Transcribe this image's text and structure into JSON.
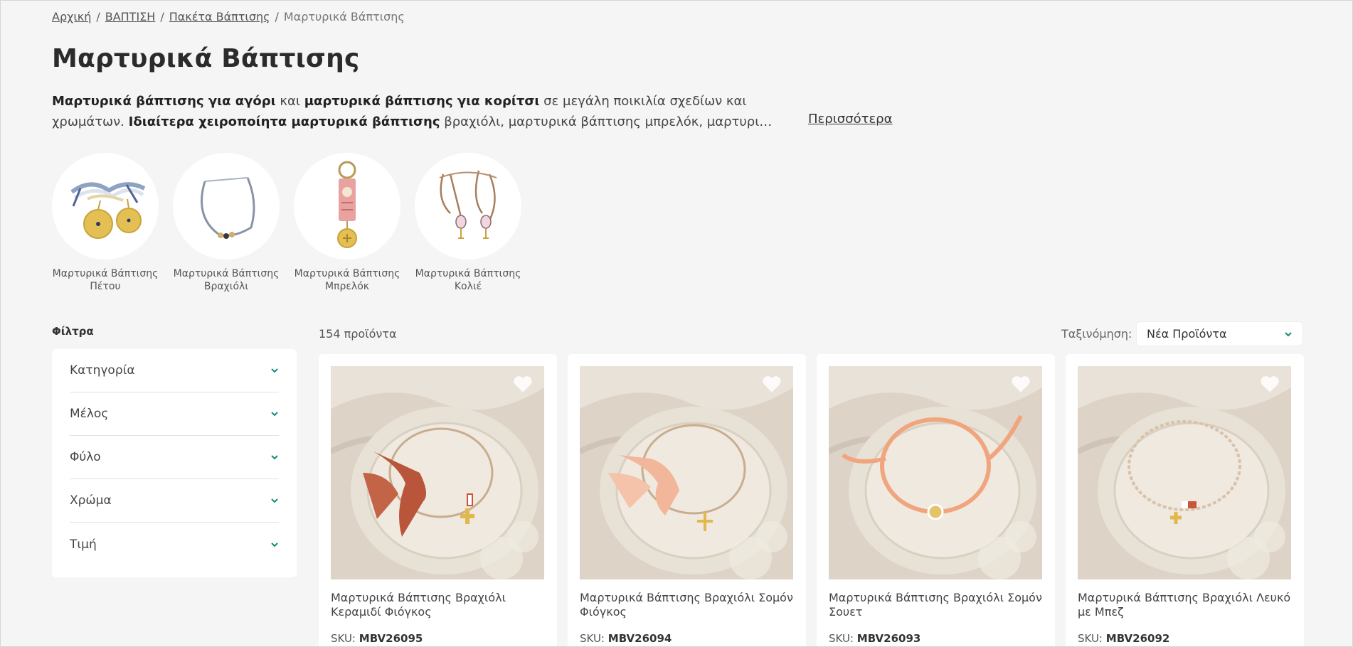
{
  "breadcrumb": {
    "items": [
      "Αρχική",
      "ΒΑΠΤΙΣΗ",
      "Πακέτα Βάπτισης"
    ],
    "current": "Μαρτυρικά Βάπτισης",
    "separator": "/"
  },
  "page_title": "Μαρτυρικά Βάπτισης",
  "intro": {
    "l1_b1": "Μαρτυρικά βάπτισης για αγόρι",
    "l1_t1": " και ",
    "l1_b2": "μαρτυρικά βάπτισης για κορίτσι",
    "l1_t2": " σε μεγάλη ποικιλία σχεδίων και",
    "l2_t1": "χρωμάτων. ",
    "l2_b1": "Ιδιαίτερα χειροποίητα μαρτυρικά βάπτισης",
    "l2_t2": " βραχιόλι, μαρτυρικά βάπτισης μπρελόκ, μαρτυρι…",
    "more_link": "Περισσότερα"
  },
  "categories": [
    {
      "line1": "Μαρτυρικά Βάπτισης",
      "line2": "Πέτου",
      "icon": "coin-pin-icon"
    },
    {
      "line1": "Μαρτυρικά Βάπτισης",
      "line2": "Βραχιόλι",
      "icon": "bracelet-icon"
    },
    {
      "line1": "Μαρτυρικά Βάπτισης",
      "line2": "Μπρελόκ",
      "icon": "keychain-icon"
    },
    {
      "line1": "Μαρτυρικά Βάπτισης",
      "line2": "Κολιέ",
      "icon": "necklace-icon"
    }
  ],
  "filters": {
    "title": "Φίλτρα",
    "items": [
      "Κατηγορία",
      "Μέλος",
      "Φύλο",
      "Χρώμα",
      "Τιμή"
    ]
  },
  "results": {
    "count": "154 προϊόντα",
    "sort_label": "Ταξινόμηση:",
    "sort_value": "Νέα Προϊόντα"
  },
  "products": [
    {
      "title": "Μαρτυρικά Βάπτισης Βραχιόλι Κεραμιδί Φιόγκος",
      "sku_label": "SKU:",
      "sku": "MBV26095",
      "cord_color": "#c8ad8e",
      "accent_color": "#b8553b"
    },
    {
      "title": "Μαρτυρικά Βάπτισης Βραχιόλι Σομόν Φιόγκος",
      "sku_label": "SKU:",
      "sku": "MBV26094",
      "cord_color": "#c8ad8e",
      "accent_color": "#f2b79a"
    },
    {
      "title": "Μαρτυρικά Βάπτισης Βραχιόλι Σομόν Σουετ",
      "sku_label": "SKU:",
      "sku": "MBV26093",
      "cord_color": "#f0a57e",
      "accent_color": "#f0a57e"
    },
    {
      "title": "Μαρτυρικά Βάπτισης Βραχιόλι Λευκό με Μπεζ",
      "sku_label": "SKU:",
      "sku": "MBV26092",
      "cord_color": "#d9c2a8",
      "accent_color": "#c9553a"
    }
  ],
  "colors": {
    "accent": "#1a8a7a",
    "background": "#f5f5f5",
    "card": "#ffffff"
  }
}
